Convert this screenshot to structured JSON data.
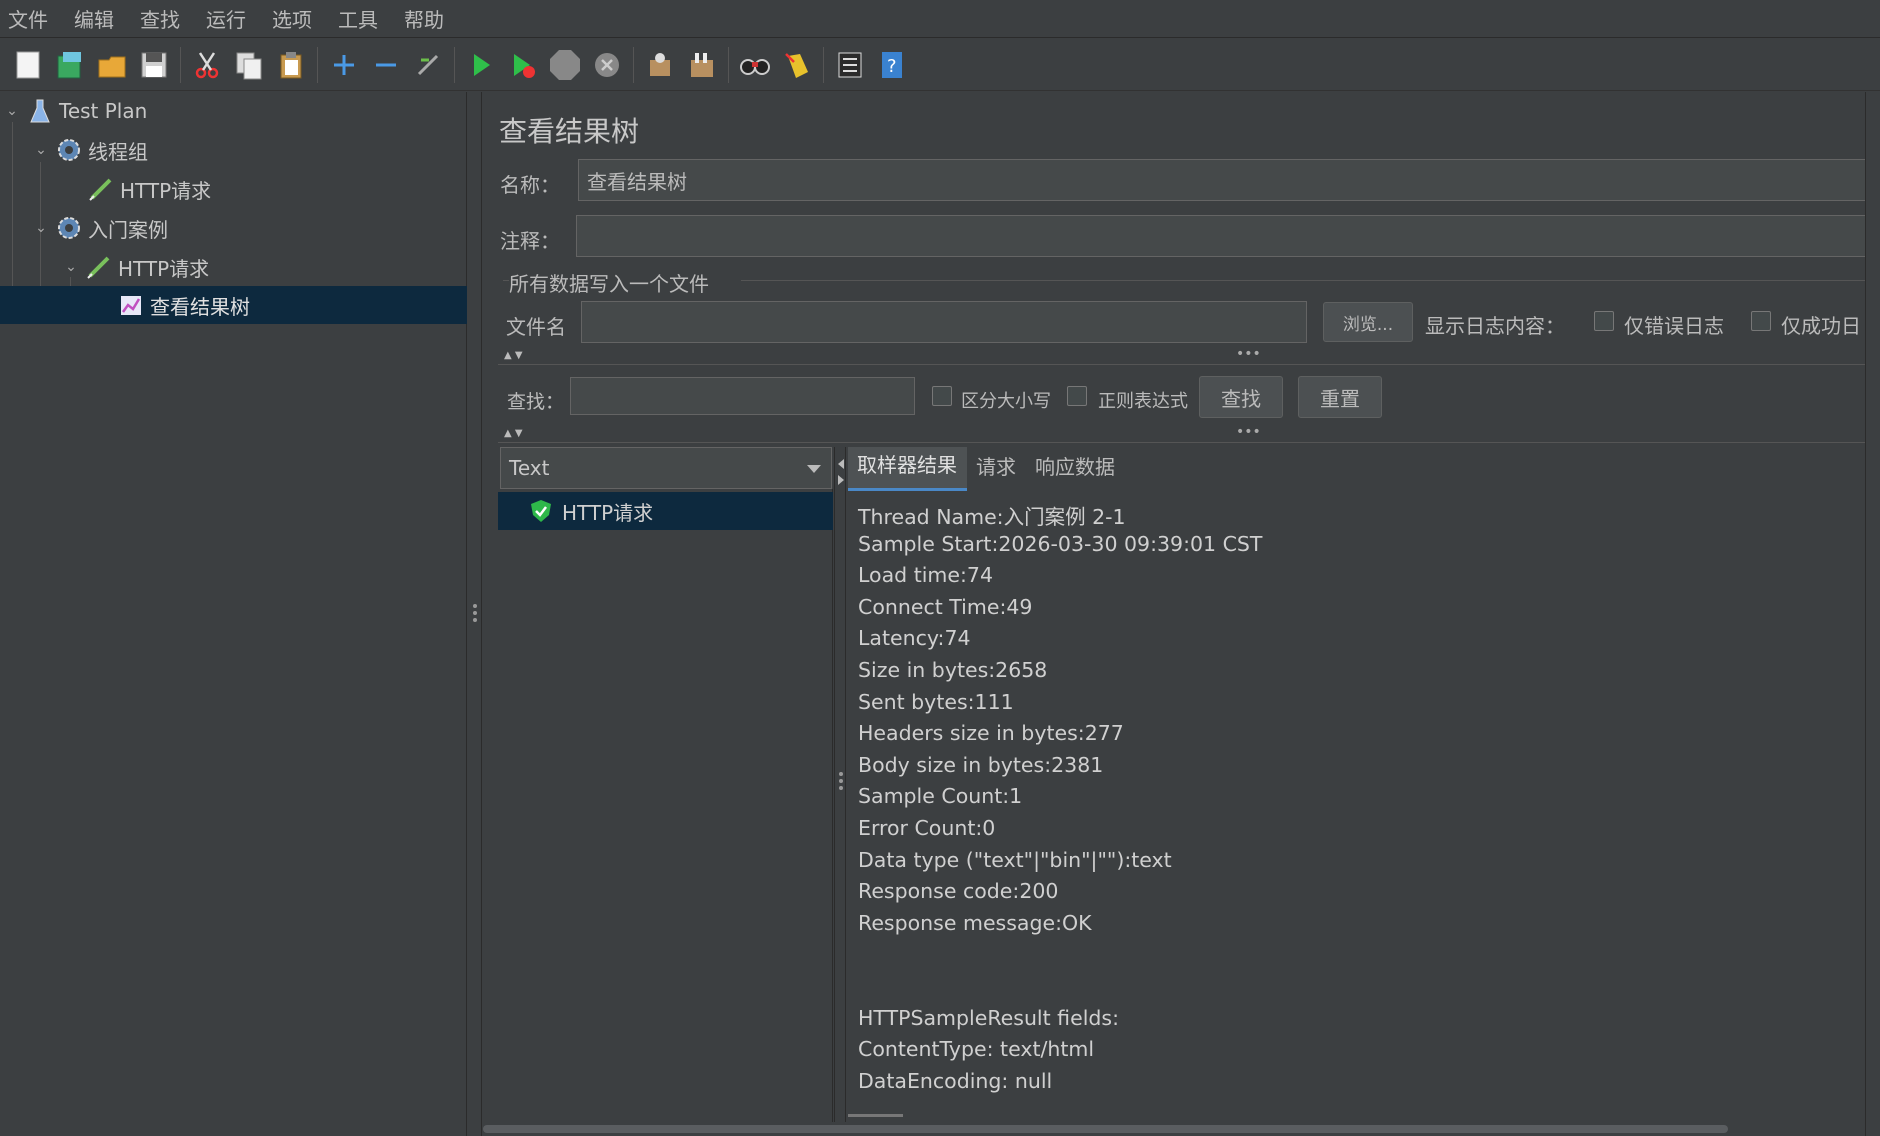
{
  "menu": [
    "文件",
    "编辑",
    "查找",
    "运行",
    "选项",
    "工具",
    "帮助"
  ],
  "toolbar": {
    "icons": [
      "new-icon",
      "templates-icon",
      "open-icon",
      "save-icon",
      "cut-icon",
      "copy-icon",
      "paste-icon",
      "expand-icon",
      "collapse-icon",
      "toggle-icon",
      "start-icon",
      "start-no-pause-icon",
      "stop-icon",
      "shutdown-icon",
      "clear-icon",
      "clear-all-icon",
      "search-icon",
      "reset-search-icon",
      "function-helper-icon",
      "help-icon"
    ]
  },
  "tree": {
    "items": [
      {
        "label": "Test Plan",
        "icon": "flask-icon"
      },
      {
        "label": "线程组",
        "icon": "gear-icon"
      },
      {
        "label": "HTTP请求",
        "icon": "pencil-icon"
      },
      {
        "label": "入门案例",
        "icon": "gear-icon"
      },
      {
        "label": "HTTP请求",
        "icon": "pencil-icon"
      },
      {
        "label": "查看结果树",
        "icon": "chart-icon"
      }
    ]
  },
  "panel": {
    "title": "查看结果树",
    "name_label": "名称：",
    "name_value": "查看结果树",
    "comment_label": "注释：",
    "comment_value": "",
    "file_section": "所有数据写入一个文件",
    "filename_label": "文件名",
    "filename_value": "",
    "browse_button": "浏览...",
    "log_label": "显示日志内容：",
    "errors_only": "仅错误日志",
    "success_only": "仅成功日"
  },
  "search": {
    "label": "查找：",
    "value": "",
    "case_sensitive": "区分大小写",
    "regex": "正则表达式",
    "find_button": "查找",
    "reset_button": "重置"
  },
  "renderer": {
    "selected": "Text"
  },
  "results": [
    {
      "label": "HTTP请求",
      "status": "success"
    }
  ],
  "tabs": [
    "取样器结果",
    "请求",
    "响应数据"
  ],
  "sample_lines": [
    "Thread Name:入门案例 2-1",
    "Sample Start:2026-03-30 09:39:01 CST",
    "Load time:74",
    "Connect Time:49",
    "Latency:74",
    "Size in bytes:2658",
    "Sent bytes:111",
    "Headers size in bytes:277",
    "Body size in bytes:2381",
    "Sample Count:1",
    "Error Count:0",
    "Data type (\"text\"|\"bin\"|\"\"):text",
    "Response code:200",
    "Response message:OK",
    "",
    "",
    "HTTPSampleResult fields:",
    "ContentType: text/html",
    "DataEncoding: null"
  ]
}
